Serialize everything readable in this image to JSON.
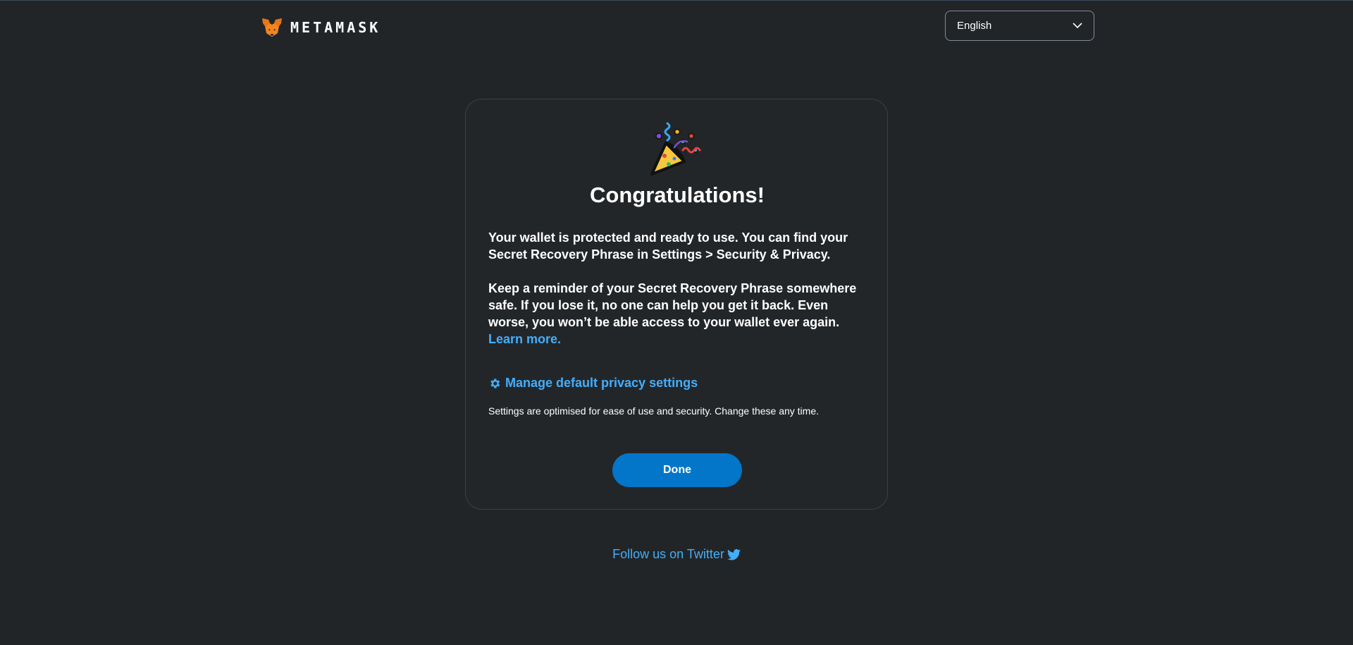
{
  "header": {
    "logo_text": "METAMASK",
    "language": {
      "selected": "English"
    }
  },
  "card": {
    "title": "Congratulations!",
    "para1_text": "Your wallet is protected and ready to use. You can find your Secret Recovery Phrase in ",
    "para1_bold": "Settings > Security & Privacy.",
    "para2_text": "Keep a reminder of your Secret Recovery Phrase somewhere safe. If you lose it, no one can help you get it back. Even worse, you won’t be able access to your wallet ever again.",
    "learn_more": "Learn more.",
    "manage_privacy": "Manage default privacy settings",
    "settings_note": "Settings are optimised for ease of use and security. Change these any time.",
    "done_label": "Done"
  },
  "footer": {
    "twitter_label": "Follow us on Twitter"
  },
  "colors": {
    "background": "#222528",
    "accent_link": "#43aefc",
    "primary_button": "#0376c9"
  }
}
